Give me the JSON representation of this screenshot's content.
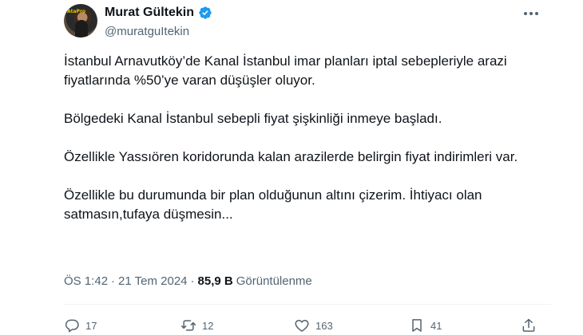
{
  "author": {
    "display_name": "Murat Gültekin",
    "handle": "@muratguItekin",
    "avatar_logo_text": "AtaPro"
  },
  "tweet": {
    "paragraphs": [
      "İstanbul Arnavutköy’de Kanal İstanbul imar planları iptal sebepleriyle arazi fiyatlarında %50’ye varan düşüşler oluyor.",
      "Bölgedeki Kanal İstanbul sebepli fiyat şişkinliği inmeye başladı.",
      "Özellikle Yassıören koridorunda kalan arazilerde belirgin fiyat indirimleri var.",
      "Özellikle bu durumunda bir plan olduğunun altını çizerim. İhtiyacı olan satmasın,tufaya düşmesin..."
    ]
  },
  "meta": {
    "time": "ÖS 1:42",
    "separator": "·",
    "date": "21 Tem 2024",
    "views_count": "85,9 B",
    "views_label": "Görüntülenme"
  },
  "actions": {
    "replies": "17",
    "reposts": "12",
    "likes": "163",
    "bookmarks": "41"
  },
  "icons": {
    "verified": "verified-badge-icon",
    "more": "more-icon",
    "reply": "reply-icon",
    "repost": "repost-icon",
    "like": "like-icon",
    "bookmark": "bookmark-icon",
    "share": "share-icon"
  },
  "colors": {
    "verified": "#1d9bf0",
    "text": "#0f1419",
    "secondary": "#536471"
  }
}
